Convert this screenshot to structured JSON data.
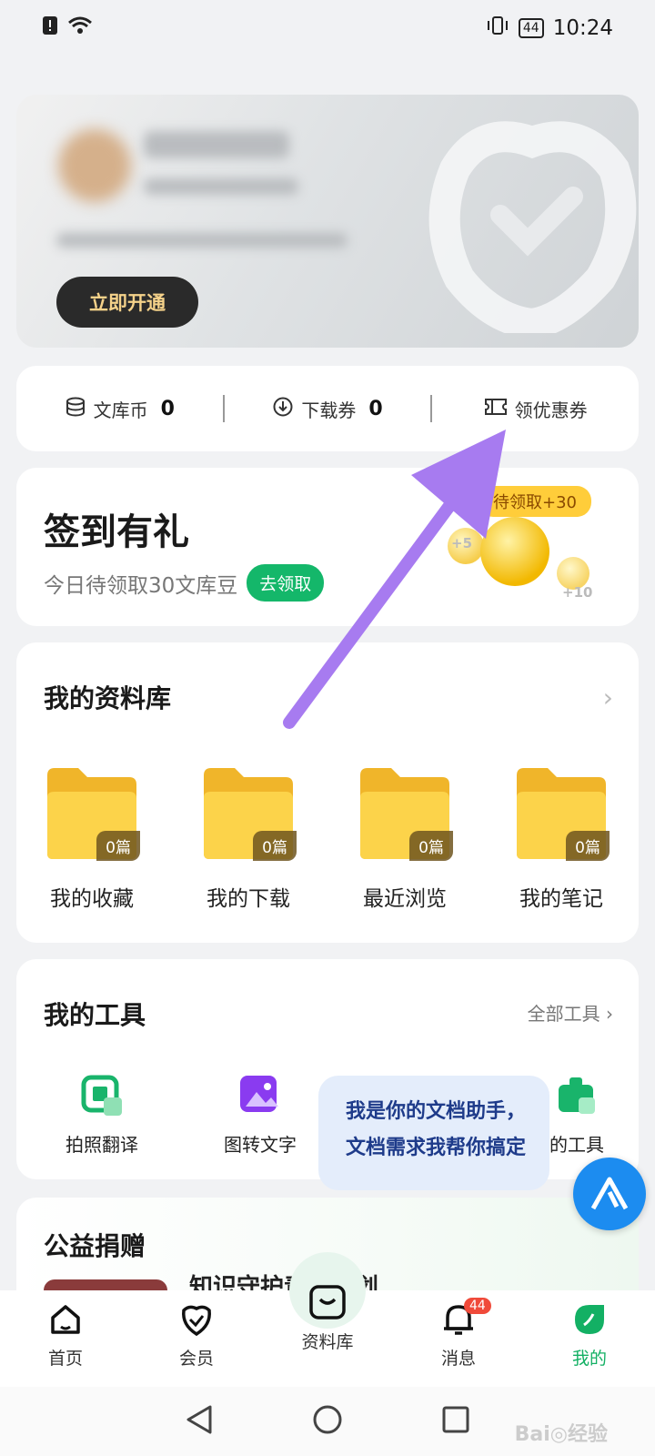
{
  "status_bar": {
    "time": "10:24",
    "battery": "44"
  },
  "vip_card": {
    "button_label": "立即开通"
  },
  "assets": {
    "items": [
      {
        "label": "文库币",
        "value": "0",
        "icon": "database-icon"
      },
      {
        "label": "下载券",
        "value": "0",
        "icon": "download-icon"
      },
      {
        "label": "领优惠券",
        "icon": "coupon-icon"
      }
    ]
  },
  "sign_in": {
    "title": "签到有礼",
    "subtitle": "今日待领取30文库豆",
    "button_label": "去领取",
    "badge": "待领取+30",
    "bean_plus5": "+5",
    "bean_plus10": "+10"
  },
  "library": {
    "title": "我的资料库",
    "folders": [
      {
        "label": "我的收藏",
        "count": "0篇"
      },
      {
        "label": "我的下载",
        "count": "0篇"
      },
      {
        "label": "最近浏览",
        "count": "0篇"
      },
      {
        "label": "我的笔记",
        "count": "0篇"
      }
    ]
  },
  "tools": {
    "title": "我的工具",
    "all_label": "全部工具",
    "items": [
      {
        "label": "拍照翻译",
        "icon": "photo-translate-icon"
      },
      {
        "label": "图转文字",
        "icon": "image-to-text-icon"
      },
      {
        "label": "",
        "icon": "tool-icon"
      },
      {
        "label": "的工具",
        "icon": "toolbox-icon"
      }
    ]
  },
  "assistant": {
    "line1": "我是你的文档助手，",
    "line2": "文档需求我帮你搞定"
  },
  "charity": {
    "title": "公益捐赠",
    "item_text": "知识守护责任计划"
  },
  "tabbar": {
    "tabs": [
      {
        "label": "首页"
      },
      {
        "label": "会员"
      },
      {
        "label": "资料库"
      },
      {
        "label": "消息",
        "badge": "44"
      },
      {
        "label": "我的"
      }
    ]
  },
  "colors": {
    "accent_green": "#13b064",
    "assistant_blue": "#1c8cf0",
    "annotation_purple": "#a77bf0"
  }
}
